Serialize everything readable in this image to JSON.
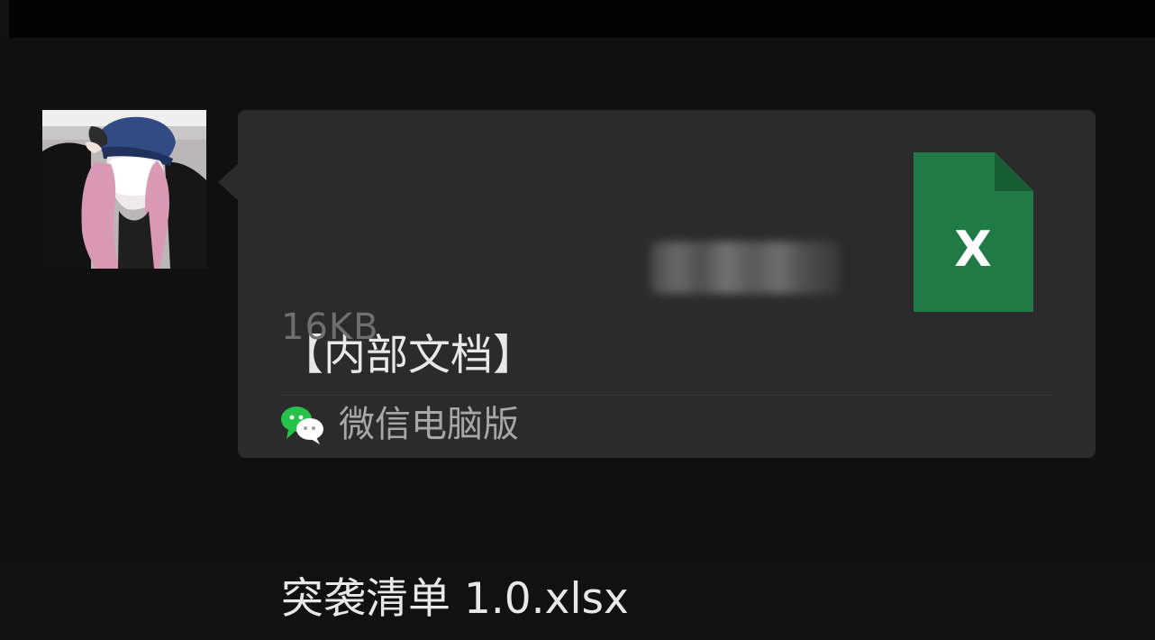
{
  "message": {
    "file_name_line1": "【内部文档】",
    "file_name_line2": "突袭清单 1.0.xlsx",
    "file_size": "16KB",
    "source_label": "微信电脑版",
    "file_icon": "excel-file-icon",
    "file_icon_letter": "X",
    "source_icon": "wechat-icon"
  },
  "colors": {
    "background": "#111111",
    "bubble": "#2b2b2b",
    "title_text": "#e8e8e8",
    "meta_text": "#6f6f6f",
    "source_text": "#a8a8a8",
    "excel_green": "#1f7a45",
    "wechat_green": "#27c24c"
  }
}
